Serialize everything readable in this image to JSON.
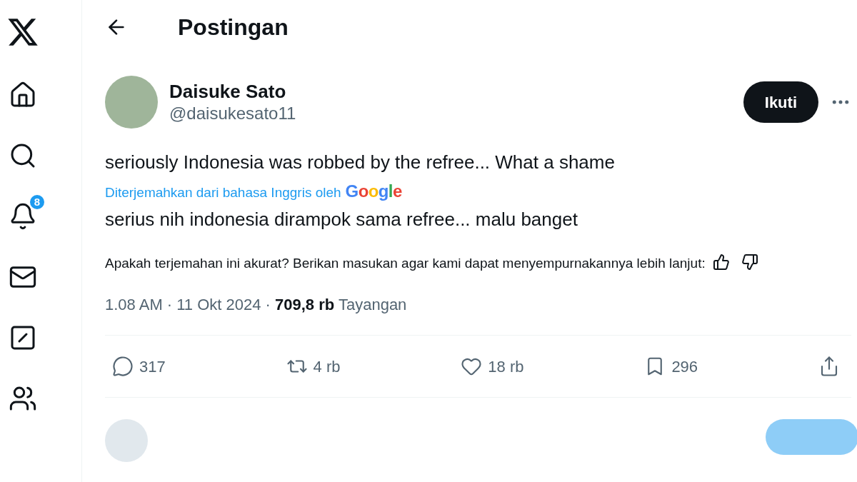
{
  "sidebar": {
    "items": [
      {
        "kind": "logo"
      },
      {
        "kind": "home"
      },
      {
        "kind": "search"
      },
      {
        "kind": "notifications",
        "badge": "8"
      },
      {
        "kind": "messages"
      },
      {
        "kind": "grok"
      },
      {
        "kind": "communities"
      }
    ]
  },
  "header": {
    "title": "Postingan"
  },
  "post": {
    "author": {
      "name": "Daisuke Sato",
      "handle": "@daisukesato11"
    },
    "follow_button": "Ikuti",
    "text": "seriously Indonesia was robbed by the refree... What a shame",
    "translation": {
      "label": "Diterjemahkan dari bahasa Inggris oleh",
      "provider": "Google"
    },
    "translated_text": "serius nih indonesia dirampok sama refree... malu banget",
    "feedback_prompt": "Apakah terjemahan ini akurat? Berikan masukan agar kami dapat menyempurnakannya lebih lanjut:",
    "meta": "1.08 AM · 11 Okt 2024 · **709,8 rb** Tayangan",
    "actions": [
      {
        "kind": "reply",
        "count": "317"
      },
      {
        "kind": "repost",
        "count": "4 rb"
      },
      {
        "kind": "like",
        "count": "18 rb"
      },
      {
        "kind": "bookmark",
        "count": "296"
      },
      {
        "kind": "share"
      }
    ]
  }
}
